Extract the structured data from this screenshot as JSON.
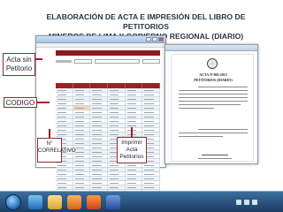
{
  "slide": {
    "title_line1": "ELABORACIÓN DE ACTA E IMPRESIÓN DEL LIBRO DE PETITORIOS",
    "title_line2": "MINEROS DE LIMA Y  GOBIERNO REGIONAL (DIARIO)"
  },
  "callouts": {
    "acta_line1": "Acta sin",
    "acta_line2": "Petitorio",
    "codigo": "CODIGO",
    "correlativo_line1": "N°",
    "correlativo_line2": "CORRELATIVO",
    "imprimir_line1": "Imprimir",
    "imprimir_line2": "Acta",
    "imprimir_line3": "Petitorios"
  },
  "document": {
    "heading1": "ACTA N°001/2015",
    "heading2": "PETITORIOS (DIARIO)"
  },
  "colors": {
    "accent": "#a51e24",
    "title_text": "#2a3547",
    "taskbar": "#1c3d63"
  },
  "icons": [
    "start-orb-icon",
    "ie-icon",
    "folder-icon",
    "media-icon",
    "firefox-icon",
    "word-icon",
    "system-tray-icons"
  ]
}
